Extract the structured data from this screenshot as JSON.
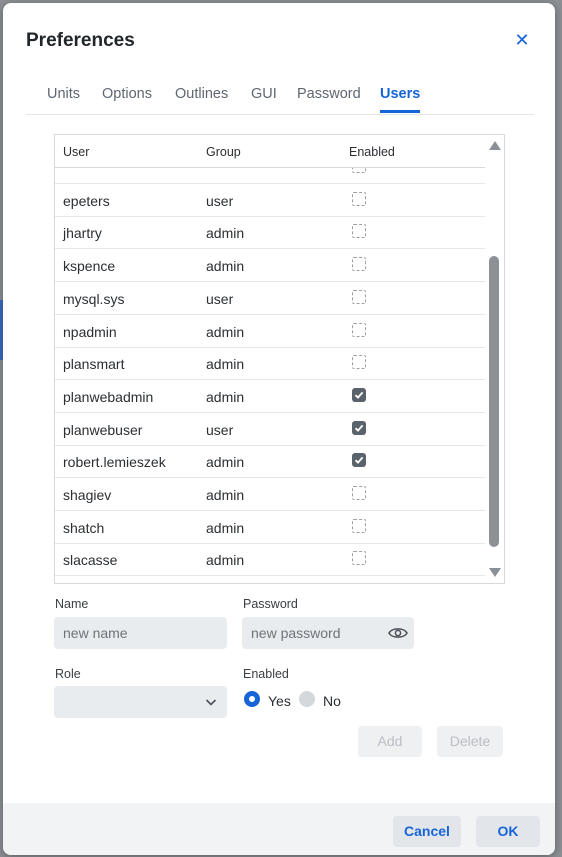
{
  "dialog": {
    "title": "Preferences",
    "close_icon": "close-icon",
    "tabs": [
      {
        "label": "Units"
      },
      {
        "label": "Options"
      },
      {
        "label": "Outlines"
      },
      {
        "label": "GUI"
      },
      {
        "label": "Password"
      },
      {
        "label": "Users",
        "active": true
      }
    ]
  },
  "users_table": {
    "columns": [
      "User",
      "Group",
      "Enabled"
    ],
    "rows": [
      {
        "user": "",
        "group": "",
        "enabled": false
      },
      {
        "user": "epeters",
        "group": "user",
        "enabled": false
      },
      {
        "user": "jhartry",
        "group": "admin",
        "enabled": false
      },
      {
        "user": "kspence",
        "group": "admin",
        "enabled": false
      },
      {
        "user": "mysql.sys",
        "group": "user",
        "enabled": false
      },
      {
        "user": "npadmin",
        "group": "admin",
        "enabled": false
      },
      {
        "user": "plansmart",
        "group": "admin",
        "enabled": false
      },
      {
        "user": "planwebadmin",
        "group": "admin",
        "enabled": true
      },
      {
        "user": "planwebuser",
        "group": "user",
        "enabled": true
      },
      {
        "user": "robert.lemieszek",
        "group": "admin",
        "enabled": true
      },
      {
        "user": "shagiev",
        "group": "admin",
        "enabled": false
      },
      {
        "user": "shatch",
        "group": "admin",
        "enabled": false
      },
      {
        "user": "slacasse",
        "group": "admin",
        "enabled": false
      },
      {
        "user": "",
        "group": "",
        "enabled": false
      }
    ]
  },
  "form": {
    "name_label": "Name",
    "name_placeholder": "new name",
    "password_label": "Password",
    "password_placeholder": "new password",
    "role_label": "Role",
    "role_value": "",
    "enabled_label": "Enabled",
    "enabled_yes": "Yes",
    "enabled_no": "No",
    "enabled_selected": "Yes",
    "add_label": "Add",
    "delete_label": "Delete"
  },
  "footer": {
    "cancel_label": "Cancel",
    "ok_label": "OK"
  },
  "colors": {
    "accent": "#1565d8",
    "checkbox_on": "#5a626c"
  }
}
